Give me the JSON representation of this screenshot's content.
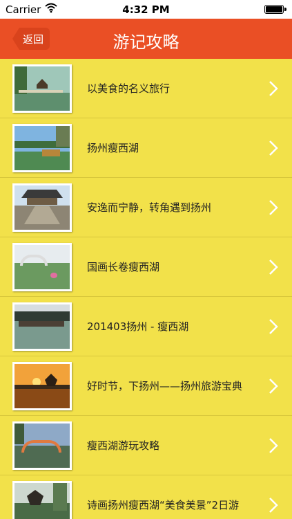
{
  "status_bar": {
    "carrier": "Carrier",
    "time": "4:32 PM",
    "wifi_icon": "wifi-icon",
    "battery_icon": "battery-icon"
  },
  "nav": {
    "back_label": "返回",
    "title": "游记攻略"
  },
  "colors": {
    "nav_bg": "#ea4f25",
    "list_bg": "#f2e14a",
    "accent": "#d9431c"
  },
  "items": [
    {
      "title": "以美食的名义旅行"
    },
    {
      "title": "扬州瘦西湖"
    },
    {
      "title": "安逸而宁静，转角遇到扬州"
    },
    {
      "title": "国画长卷瘦西湖"
    },
    {
      "title": "201403扬州 - 瘦西湖"
    },
    {
      "title": "好时节，下扬州——扬州旅游宝典"
    },
    {
      "title": "瘦西湖游玩攻略"
    },
    {
      "title": "诗画扬州瘦西湖“美食美景”2日游"
    }
  ]
}
